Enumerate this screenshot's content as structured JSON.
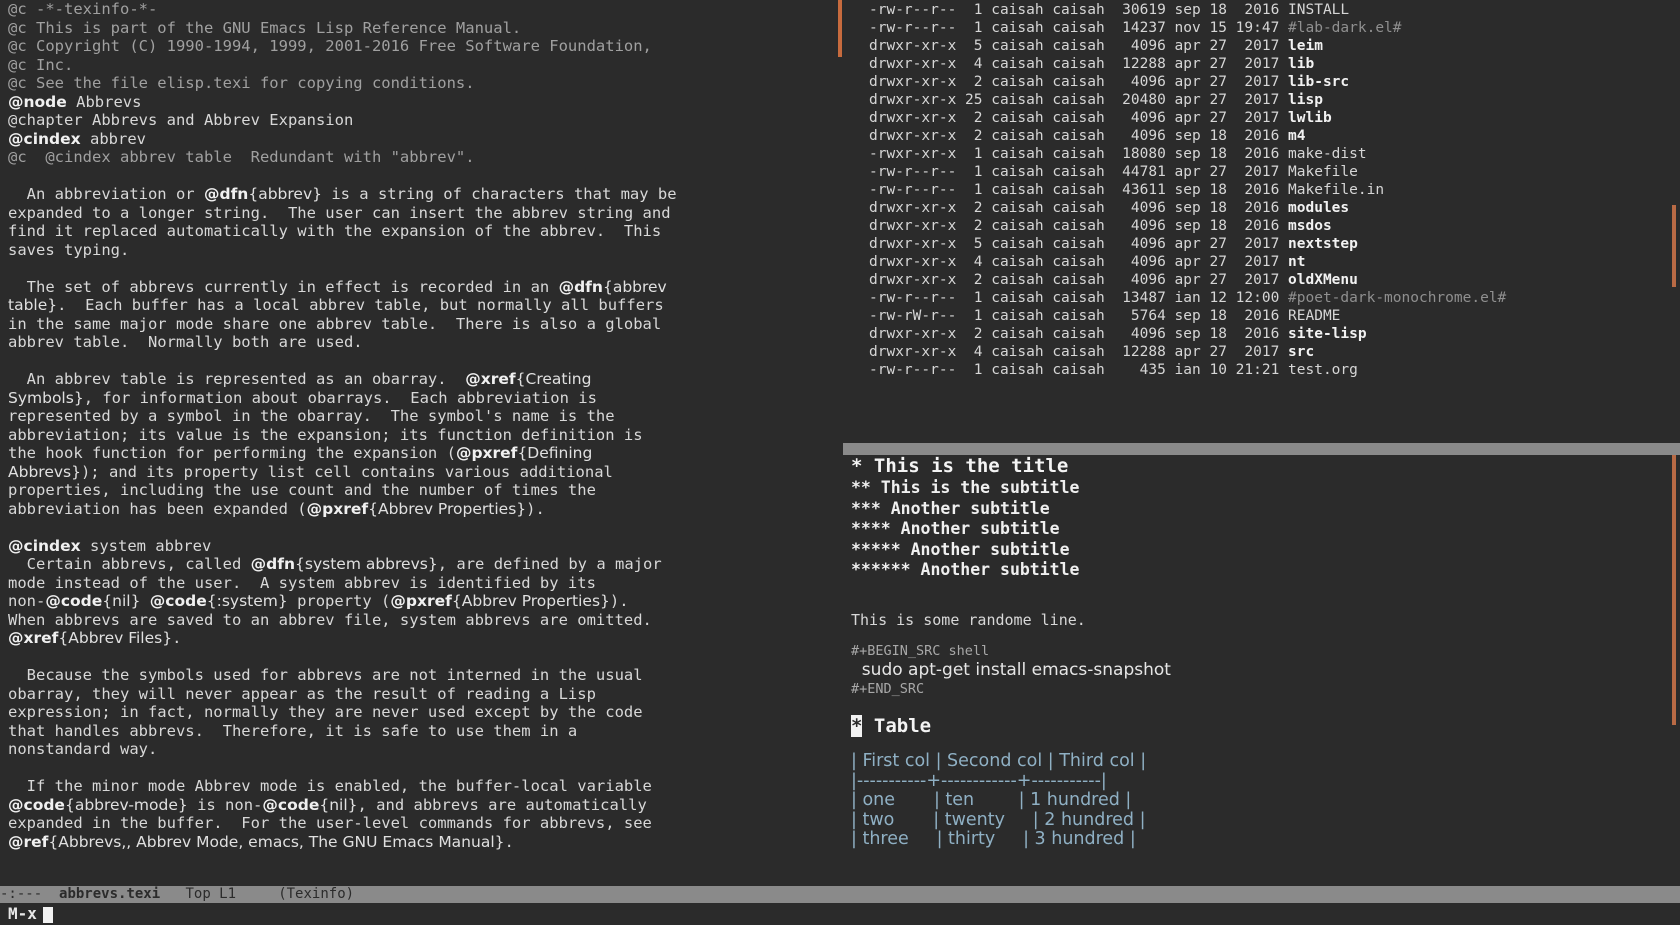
{
  "texinfo": {
    "lines": [
      [
        {
          "t": "@c -*-texinfo-*-",
          "c": "c"
        }
      ],
      [
        {
          "t": "@c This is part of the GNU Emacs Lisp Reference Manual.",
          "c": "c"
        }
      ],
      [
        {
          "t": "@c Copyright (C) 1990-1994, 1999, 2001-2016 Free Software Foundation,",
          "c": "c"
        }
      ],
      [
        {
          "t": "@c Inc.",
          "c": "c"
        }
      ],
      [
        {
          "t": "@c See the file elisp.texi for copying conditions.",
          "c": "c"
        }
      ],
      [
        {
          "t": "@node",
          "c": "kw"
        },
        {
          "t": " Abbrevs"
        }
      ],
      [
        {
          "t": "@chapter Abbrevs and Abbrev Expansion"
        }
      ],
      [
        {
          "t": "@cindex",
          "c": "kw"
        },
        {
          "t": " abbrev"
        }
      ],
      [
        {
          "t": "@c  @cindex abbrev table  Redundant with \"abbrev\".",
          "c": "c"
        }
      ],
      [
        {
          "t": ""
        }
      ],
      [
        {
          "t": "  An abbreviation or "
        },
        {
          "t": "@dfn",
          "c": "kw"
        },
        {
          "t": "{abbrev}",
          "c": "arg"
        },
        {
          "t": " is a string of characters that may be"
        }
      ],
      [
        {
          "t": "expanded to a longer string.  The user can insert the abbrev string and"
        }
      ],
      [
        {
          "t": "find it replaced automatically with the expansion of the abbrev.  This"
        }
      ],
      [
        {
          "t": "saves typing."
        }
      ],
      [
        {
          "t": ""
        }
      ],
      [
        {
          "t": "  The set of abbrevs currently in effect is recorded in an "
        },
        {
          "t": "@dfn",
          "c": "kw"
        },
        {
          "t": "{abbrev",
          "c": "arg"
        }
      ],
      [
        {
          "t": "table}",
          "c": "arg"
        },
        {
          "t": ".  Each buffer has a local abbrev table, but normally all buffers"
        }
      ],
      [
        {
          "t": "in the same major mode share one abbrev table.  There is also a global"
        }
      ],
      [
        {
          "t": "abbrev table.  Normally both are used."
        }
      ],
      [
        {
          "t": ""
        }
      ],
      [
        {
          "t": "  An abbrev table is represented as an obarray.  "
        },
        {
          "t": "@xref",
          "c": "kw"
        },
        {
          "t": "{Creating",
          "c": "arg"
        }
      ],
      [
        {
          "t": "Symbols}",
          "c": "arg"
        },
        {
          "t": ", for information about obarrays.  Each abbreviation is"
        }
      ],
      [
        {
          "t": "represented by a symbol in the obarray.  The symbol's name is the"
        }
      ],
      [
        {
          "t": "abbreviation; its value is the expansion; its function definition is"
        }
      ],
      [
        {
          "t": "the hook function for performing the expansion ("
        },
        {
          "t": "@pxref",
          "c": "kw"
        },
        {
          "t": "{Defining",
          "c": "arg"
        }
      ],
      [
        {
          "t": "Abbrevs}",
          "c": "arg"
        },
        {
          "t": "); and its property list cell contains various additional"
        }
      ],
      [
        {
          "t": "properties, including the use count and the number of times the"
        }
      ],
      [
        {
          "t": "abbreviation has been expanded ("
        },
        {
          "t": "@pxref",
          "c": "kw"
        },
        {
          "t": "{Abbrev Properties}",
          "c": "arg"
        },
        {
          "t": ")."
        }
      ],
      [
        {
          "t": ""
        }
      ],
      [
        {
          "t": "@cindex",
          "c": "kw"
        },
        {
          "t": " system abbrev"
        }
      ],
      [
        {
          "t": "  Certain abbrevs, called "
        },
        {
          "t": "@dfn",
          "c": "kw"
        },
        {
          "t": "{system abbrevs}",
          "c": "arg"
        },
        {
          "t": ", are defined by a major"
        }
      ],
      [
        {
          "t": "mode instead of the user.  A system abbrev is identified by its"
        }
      ],
      [
        {
          "t": "non-"
        },
        {
          "t": "@code",
          "c": "kw"
        },
        {
          "t": "{nil}",
          "c": "arg"
        },
        {
          "t": " "
        },
        {
          "t": "@code",
          "c": "kw"
        },
        {
          "t": "{:system}",
          "c": "arg"
        },
        {
          "t": " property ("
        },
        {
          "t": "@pxref",
          "c": "kw"
        },
        {
          "t": "{Abbrev Properties}",
          "c": "arg"
        },
        {
          "t": ")."
        }
      ],
      [
        {
          "t": "When abbrevs are saved to an abbrev file, system abbrevs are omitted."
        }
      ],
      [
        {
          "t": "@xref",
          "c": "kw"
        },
        {
          "t": "{Abbrev Files}",
          "c": "arg"
        },
        {
          "t": "."
        }
      ],
      [
        {
          "t": ""
        }
      ],
      [
        {
          "t": "  Because the symbols used for abbrevs are not interned in the usual"
        }
      ],
      [
        {
          "t": "obarray, they will never appear as the result of reading a Lisp"
        }
      ],
      [
        {
          "t": "expression; in fact, normally they are never used except by the code"
        }
      ],
      [
        {
          "t": "that handles abbrevs.  Therefore, it is safe to use them in a"
        }
      ],
      [
        {
          "t": "nonstandard way."
        }
      ],
      [
        {
          "t": ""
        }
      ],
      [
        {
          "t": "  If the minor mode Abbrev mode is enabled, the buffer-local variable"
        }
      ],
      [
        {
          "t": "@code",
          "c": "kw"
        },
        {
          "t": "{abbrev-mode}",
          "c": "arg"
        },
        {
          "t": " is non-"
        },
        {
          "t": "@code",
          "c": "kw"
        },
        {
          "t": "{nil}",
          "c": "arg"
        },
        {
          "t": ", and abbrevs are automatically"
        }
      ],
      [
        {
          "t": "expanded in the buffer.  For the user-level commands for abbrevs, see"
        }
      ],
      [
        {
          "t": "@ref",
          "c": "kw"
        },
        {
          "t": "{Abbrevs,, Abbrev Mode, emacs, The GNU Emacs Manual}",
          "c": "arg"
        },
        {
          "t": "."
        }
      ]
    ]
  },
  "modeline": {
    "flags": "-:---",
    "buffer": "abbrevs.texi",
    "position": "Top L1",
    "mode": "(Texinfo)"
  },
  "minibuffer": {
    "prompt": "M-x"
  },
  "dired": {
    "rows": [
      {
        "perm": "-rw-r--r--",
        "links": "1",
        "owner": "caisah",
        "group": "caisah",
        "size": "30619",
        "date": "sep 18  2016",
        "name": "INSTALL",
        "kind": "file"
      },
      {
        "perm": "-rw-r--r--",
        "links": "1",
        "owner": "caisah",
        "group": "caisah",
        "size": "14237",
        "date": "nov 15 19:47",
        "name": "#lab-dark.el#",
        "kind": "tmp"
      },
      {
        "perm": "drwxr-xr-x",
        "links": "5",
        "owner": "caisah",
        "group": "caisah",
        "size": "4096",
        "date": "apr 27  2017",
        "name": "leim",
        "kind": "dir"
      },
      {
        "perm": "drwxr-xr-x",
        "links": "4",
        "owner": "caisah",
        "group": "caisah",
        "size": "12288",
        "date": "apr 27  2017",
        "name": "lib",
        "kind": "dir"
      },
      {
        "perm": "drwxr-xr-x",
        "links": "2",
        "owner": "caisah",
        "group": "caisah",
        "size": "4096",
        "date": "apr 27  2017",
        "name": "lib-src",
        "kind": "dir"
      },
      {
        "perm": "drwxr-xr-x",
        "links": "25",
        "owner": "caisah",
        "group": "caisah",
        "size": "20480",
        "date": "apr 27  2017",
        "name": "lisp",
        "kind": "dir"
      },
      {
        "perm": "drwxr-xr-x",
        "links": "2",
        "owner": "caisah",
        "group": "caisah",
        "size": "4096",
        "date": "apr 27  2017",
        "name": "lwlib",
        "kind": "dir"
      },
      {
        "perm": "drwxr-xr-x",
        "links": "2",
        "owner": "caisah",
        "group": "caisah",
        "size": "4096",
        "date": "sep 18  2016",
        "name": "m4",
        "kind": "dir"
      },
      {
        "perm": "-rwxr-xr-x",
        "links": "1",
        "owner": "caisah",
        "group": "caisah",
        "size": "18080",
        "date": "sep 18  2016",
        "name": "make-dist",
        "kind": "file"
      },
      {
        "perm": "-rw-r--r--",
        "links": "1",
        "owner": "caisah",
        "group": "caisah",
        "size": "44781",
        "date": "apr 27  2017",
        "name": "Makefile",
        "kind": "file"
      },
      {
        "perm": "-rw-r--r--",
        "links": "1",
        "owner": "caisah",
        "group": "caisah",
        "size": "43611",
        "date": "sep 18  2016",
        "name": "Makefile.in",
        "kind": "file"
      },
      {
        "perm": "drwxr-xr-x",
        "links": "2",
        "owner": "caisah",
        "group": "caisah",
        "size": "4096",
        "date": "sep 18  2016",
        "name": "modules",
        "kind": "dir"
      },
      {
        "perm": "drwxr-xr-x",
        "links": "2",
        "owner": "caisah",
        "group": "caisah",
        "size": "4096",
        "date": "sep 18  2016",
        "name": "msdos",
        "kind": "dir"
      },
      {
        "perm": "drwxr-xr-x",
        "links": "5",
        "owner": "caisah",
        "group": "caisah",
        "size": "4096",
        "date": "apr 27  2017",
        "name": "nextstep",
        "kind": "dir"
      },
      {
        "perm": "drwxr-xr-x",
        "links": "4",
        "owner": "caisah",
        "group": "caisah",
        "size": "4096",
        "date": "apr 27  2017",
        "name": "nt",
        "kind": "dir"
      },
      {
        "perm": "drwxr-xr-x",
        "links": "2",
        "owner": "caisah",
        "group": "caisah",
        "size": "4096",
        "date": "apr 27  2017",
        "name": "oldXMenu",
        "kind": "dir"
      },
      {
        "perm": "-rw-r--r--",
        "links": "1",
        "owner": "caisah",
        "group": "caisah",
        "size": "13487",
        "date": "ian 12 12:00",
        "name": "#poet-dark-monochrome.el#",
        "kind": "tmp"
      },
      {
        "perm": "-rw-rW-r--",
        "links": "1",
        "owner": "caisah",
        "group": "caisah",
        "size": "5764",
        "date": "sep 18  2016",
        "name": "README",
        "kind": "file"
      },
      {
        "perm": "drwxr-xr-x",
        "links": "2",
        "owner": "caisah",
        "group": "caisah",
        "size": "4096",
        "date": "sep 18  2016",
        "name": "site-lisp",
        "kind": "dir"
      },
      {
        "perm": "drwxr-xr-x",
        "links": "4",
        "owner": "caisah",
        "group": "caisah",
        "size": "12288",
        "date": "apr 27  2017",
        "name": "src",
        "kind": "dir"
      },
      {
        "perm": "-rw-r--r--",
        "links": "1",
        "owner": "caisah",
        "group": "caisah",
        "size": "435",
        "date": "ian 10 21:21",
        "name": "test.org",
        "kind": "file"
      }
    ]
  },
  "org": {
    "title": "* This is the title",
    "subtitles": [
      "** This is the subtitle",
      "*** Another subtitle",
      "**** Another subtitle",
      "***** Another subtitle",
      "****** Another subtitle"
    ],
    "random_line": "This is some randome line.",
    "src_begin": "#+BEGIN_SRC shell",
    "src_code": "  sudo apt-get install emacs-snapshot",
    "src_end": "#+END_SRC",
    "table_heading_star": "*",
    "table_heading_text": " Table",
    "table_rows": [
      "| First col | Second col | Third col |",
      "|-----------+------------+-----------|",
      "| one       | ten        | 1 hundred |",
      "| two       | twenty     | 2 hundred |",
      "| three     | thirty     | 3 hundred |"
    ]
  },
  "colors": {
    "background": "#2b2b2b",
    "modeline": "#8a8a8a",
    "scrollbar": "#c76b3e",
    "table_text": "#8fb0c4"
  }
}
